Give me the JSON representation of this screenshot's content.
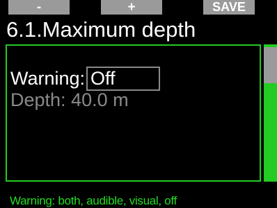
{
  "softkeys": {
    "left_label": "-",
    "middle_label": "+",
    "right_label": "SAVE"
  },
  "screen": {
    "title": "6.1.Maximum depth"
  },
  "settings": {
    "warning": {
      "label": "Warning:",
      "value": "Off"
    },
    "depth": {
      "label": "Depth:",
      "value": "40.0 m"
    }
  },
  "help": {
    "text": "Warning: both, audible, visual, off"
  },
  "colors": {
    "accent": "#22cc22",
    "softkey_bg": "#9a9a9a",
    "inactive_text": "#8a8a8a"
  },
  "icons": [
    "scrollbar-thumb"
  ]
}
